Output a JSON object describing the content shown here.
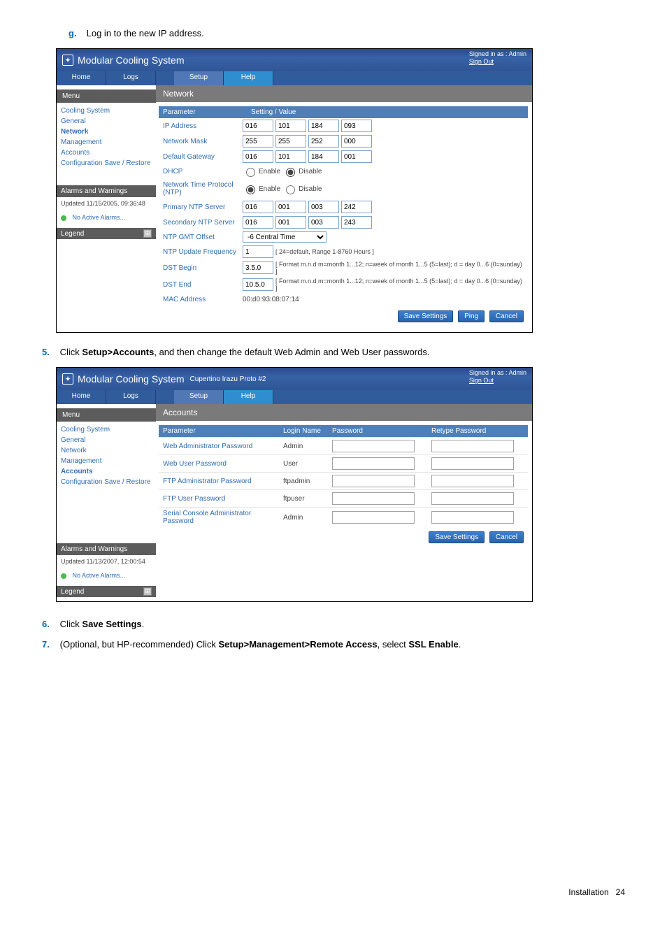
{
  "steps": {
    "g_marker": "g.",
    "g_text": "Log in to the new IP address.",
    "s5_marker": "5.",
    "s5_a": "Click ",
    "s5_b": "Setup>Accounts",
    "s5_c": ", and then change the default Web Admin and Web User passwords.",
    "s6_marker": "6.",
    "s6_a": "Click ",
    "s6_b": "Save Settings",
    "s6_c": ".",
    "s7_marker": "7.",
    "s7_a": "(Optional, but HP-recommended) Click ",
    "s7_b": "Setup>Management>Remote Access",
    "s7_c": ", select ",
    "s7_d": "SSL Enable",
    "s7_e": "."
  },
  "footer": {
    "label": "Installation",
    "page": "24"
  },
  "ss1": {
    "title": "Modular Cooling System",
    "signed_as_label": "Signed in as :",
    "signed_as_value": "Admin",
    "signout": "Sign Out",
    "tabs": {
      "home": "Home",
      "logs": "Logs",
      "setup": "Setup",
      "help": "Help"
    },
    "menu_label": "Menu",
    "section": "Network",
    "menu": [
      "Cooling System",
      "General",
      "Network",
      "Management",
      "Accounts",
      "Configuration Save / Restore"
    ],
    "menu_active_index": 2,
    "alarms_head": "Alarms and Warnings",
    "alarms_updated": "Updated 11/15/2005, 09:36:48",
    "no_alarms": "No Active Alarms...",
    "legend": "Legend",
    "table_heads": {
      "param": "Parameter",
      "setting": "Setting / Value"
    },
    "rows": {
      "ip_label": "IP Address",
      "ip": [
        "016",
        "101",
        "184",
        "093"
      ],
      "mask_label": "Network Mask",
      "mask": [
        "255",
        "255",
        "252",
        "000"
      ],
      "gw_label": "Default Gateway",
      "gw": [
        "016",
        "101",
        "184",
        "001"
      ],
      "dhcp_label": "DHCP",
      "enable": "Enable",
      "disable": "Disable",
      "ntp_label": "Network Time Protocol (NTP)",
      "pntp_label": "Primary NTP Server",
      "pntp": [
        "016",
        "001",
        "003",
        "242"
      ],
      "sntp_label": "Secondary NTP Server",
      "sntp": [
        "016",
        "001",
        "003",
        "243"
      ],
      "gmt_label": "NTP GMT Offset",
      "gmt_val": "-6 Central Time",
      "freq_label": "NTP Update Frequency",
      "freq_val": "1",
      "freq_note": "[ 24=default, Range 1-8760 Hours ]",
      "dstb_label": "DST Begin",
      "dstb_val": "3.5.0",
      "dst_note": "[ Format m.n.d m=month 1...12; n=week of month 1...5 (5=last); d = day 0...6 (0=sunday) ]",
      "dste_label": "DST End",
      "dste_val": "10.5.0",
      "mac_label": "MAC Address",
      "mac_val": "00:d0:93:08:07:14"
    },
    "buttons": {
      "save": "Save Settings",
      "ping": "Ping",
      "cancel": "Cancel"
    }
  },
  "ss2": {
    "title": "Modular Cooling System",
    "subtitle": "Cupertino Irazu Proto #2",
    "signed_as_label": "Signed in as :",
    "signed_as_value": "Admin",
    "signout": "Sign Out",
    "tabs": {
      "home": "Home",
      "logs": "Logs",
      "setup": "Setup",
      "help": "Help"
    },
    "menu_label": "Menu",
    "section": "Accounts",
    "menu": [
      "Cooling System",
      "General",
      "Network",
      "Management",
      "Accounts",
      "Configuration Save / Restore"
    ],
    "menu_active_index": 4,
    "alarms_head": "Alarms and Warnings",
    "alarms_updated": "Updated 11/13/2007, 12:00:54",
    "no_alarms": "No Active Alarms...",
    "legend": "Legend",
    "heads": {
      "param": "Parameter",
      "login": "Login Name",
      "pass": "Password",
      "retype": "Retype Password"
    },
    "rows": [
      {
        "param": "Web Administrator Password",
        "login": "Admin"
      },
      {
        "param": "Web User Password",
        "login": "User"
      },
      {
        "param": "FTP Administrator Password",
        "login": "ftpadmin"
      },
      {
        "param": "FTP User Password",
        "login": "ftpuser"
      },
      {
        "param": "Serial Console Administrator Password",
        "login": "Admin"
      }
    ],
    "buttons": {
      "save": "Save Settings",
      "cancel": "Cancel"
    }
  }
}
